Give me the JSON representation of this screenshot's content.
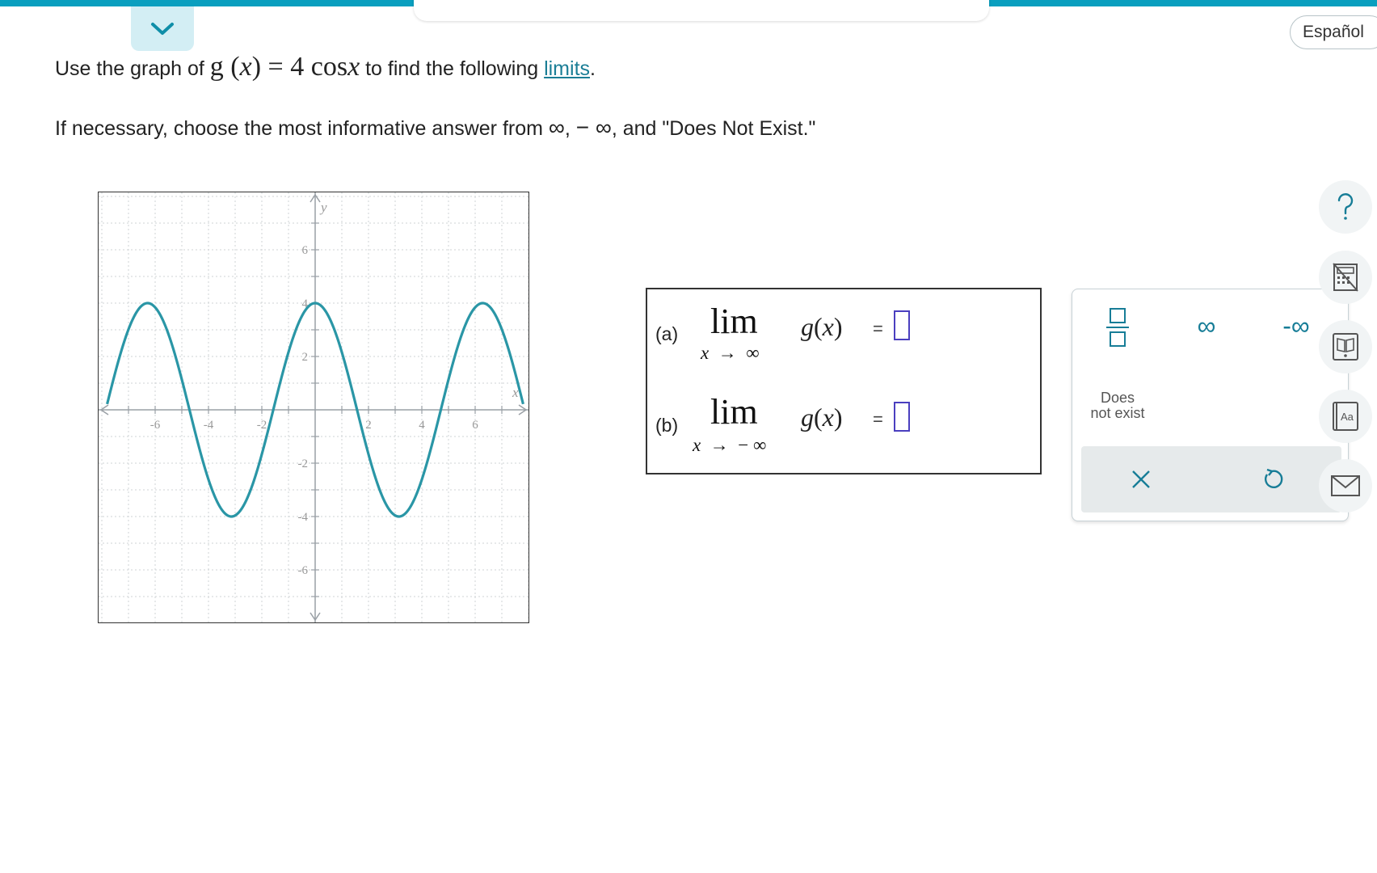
{
  "header": {
    "language_button": "Español"
  },
  "question": {
    "prefix": "Use the graph of ",
    "func_g": "g",
    "func_x": "x",
    "func_eq": " = 4 ",
    "func_cos": "cos",
    "func_arg": "x",
    "middle": " to find the following ",
    "link_text": "limits",
    "period": "."
  },
  "instruction": {
    "prefix": "If necessary, choose the most informative answer from ",
    "inf": "∞",
    "sep": ", ",
    "neg_inf": "− ∞",
    "suffix": ", and \"Does Not Exist.\""
  },
  "graph": {
    "axis_x_label": "x",
    "axis_y_label": "y",
    "x_ticks": [
      "-6",
      "-4",
      "-2",
      "2",
      "4",
      "6"
    ],
    "y_ticks": [
      "6",
      "4",
      "2",
      "-2",
      "-4",
      "-6"
    ],
    "curve_color": "#2a96a6"
  },
  "chart_data": {
    "type": "line",
    "title": "",
    "function": "g(x) = 4 cos x",
    "xlim": [
      -8,
      8
    ],
    "ylim": [
      -8,
      8
    ],
    "grid": true,
    "series": [
      {
        "color": "#2a96a6",
        "x": [
          -7.8,
          -6.28,
          -4.71,
          -3.14,
          -1.57,
          0,
          1.57,
          3.14,
          4.71,
          6.28,
          7.8
        ],
        "y": [
          0.22,
          4,
          0,
          -4,
          0,
          4,
          0,
          -4,
          0,
          4,
          0.22
        ]
      }
    ]
  },
  "answers": {
    "part_a": {
      "label": "(a)",
      "lim": "lim",
      "sub_var": "x",
      "sub_arrow": "→",
      "sub_target": "∞",
      "func_g": "g",
      "func_paren_open": "(",
      "func_var": "x",
      "func_paren_close": ")",
      "equals": "="
    },
    "part_b": {
      "label": "(b)",
      "lim": "lim",
      "sub_var": "x",
      "sub_arrow": "→",
      "sub_target": "− ∞",
      "func_g": "g",
      "func_paren_open": "(",
      "func_var": "x",
      "func_paren_close": ")",
      "equals": "="
    }
  },
  "palette": {
    "fraction_key": "fraction-icon",
    "infinity_key": "∞",
    "neg_infinity_key": "-∞",
    "dne_line1": "Does",
    "dne_line2": "not exist",
    "clear_icon": "close-icon",
    "undo_icon": "undo-icon"
  },
  "side_tools": [
    "help-icon",
    "calculator-icon",
    "book-icon",
    "glossary-icon",
    "mail-icon"
  ],
  "colors": {
    "accent": "#0a9fbf",
    "link": "#1b7e96",
    "palette_key": "#177d97",
    "input_border": "#4a3fbf"
  }
}
